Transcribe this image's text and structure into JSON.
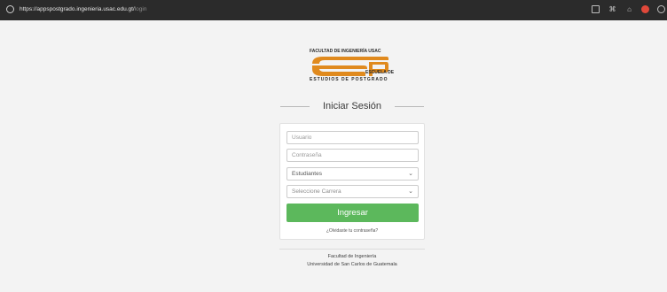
{
  "browser": {
    "url_main": "https://appspostgrado.ingenieria.usac.edu.gt/",
    "url_path": "login",
    "icons": [
      "lock-icon",
      "screen-icon",
      "extensions-icon",
      "tab-icon",
      "notification-icon",
      "profile-icon"
    ]
  },
  "logo": {
    "top_text": "FACULTAD DE INGENIERÍA USAC",
    "side_text": "ESCUELA DE",
    "bottom_text": "ESTUDIOS DE POSTGRADO",
    "colors": {
      "orange": "#e08a1e",
      "dark": "#2a2a2a"
    }
  },
  "login": {
    "title": "Iniciar Sesión",
    "username_placeholder": "Usuario",
    "password_placeholder": "Contraseña",
    "role_selected": "Estudiantes",
    "career_selected": "Seleccione Carrera",
    "submit_label": "Ingresar",
    "forgot_link": "¿Olvidaste tu contraseña?",
    "button_color": "#5cb85c"
  },
  "footer": {
    "line1": "Facultad de Ingeniería",
    "line2": "Universidad de San Carlos de Guatemala"
  }
}
